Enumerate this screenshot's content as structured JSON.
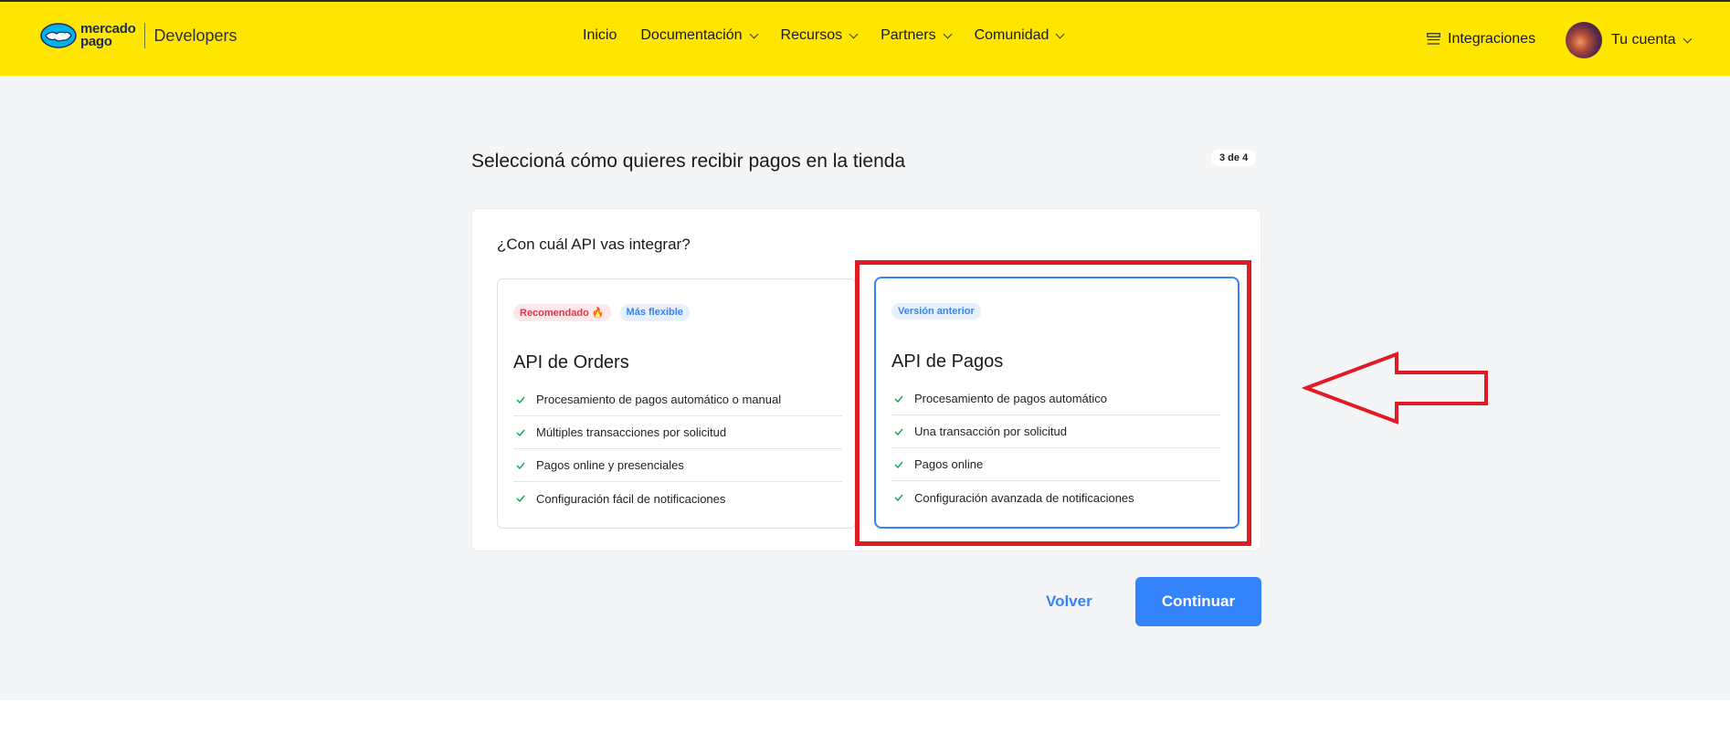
{
  "header": {
    "logo_line1": "mercado",
    "logo_line2": "pago",
    "logo_product": "Developers",
    "nav": [
      {
        "label": "Inicio",
        "dropdown": false
      },
      {
        "label": "Documentación",
        "dropdown": true
      },
      {
        "label": "Recursos",
        "dropdown": true
      },
      {
        "label": "Partners",
        "dropdown": true
      },
      {
        "label": "Comunidad",
        "dropdown": true
      }
    ],
    "integrations_label": "Integraciones",
    "account_label": "Tu cuenta",
    "brand_color": "#ffe600"
  },
  "page": {
    "title": "Seleccioná cómo quieres recibir pagos en la tienda",
    "step": "3 de 4",
    "question": "¿Con cuál API vas integrar?"
  },
  "options": {
    "orders": {
      "tag1": "Recomendado 🔥",
      "tag2": "Más flexible",
      "title": "API de Orders",
      "features": [
        "Procesamiento de pagos automático o manual",
        "Múltiples transacciones por solicitud",
        "Pagos online y presenciales",
        "Configuración fácil de notificaciones"
      ]
    },
    "pagos": {
      "tag1": "Versión anterior",
      "title": "API de Pagos",
      "selected": true,
      "features": [
        "Procesamiento de pagos automático",
        "Una transacción por solicitud",
        "Pagos online",
        "Configuración avanzada de notificaciones"
      ]
    }
  },
  "actions": {
    "back_label": "Volver",
    "continue_label": "Continuar",
    "accent_color": "#3483fa"
  },
  "annotation": {
    "color": "#e01b24"
  }
}
